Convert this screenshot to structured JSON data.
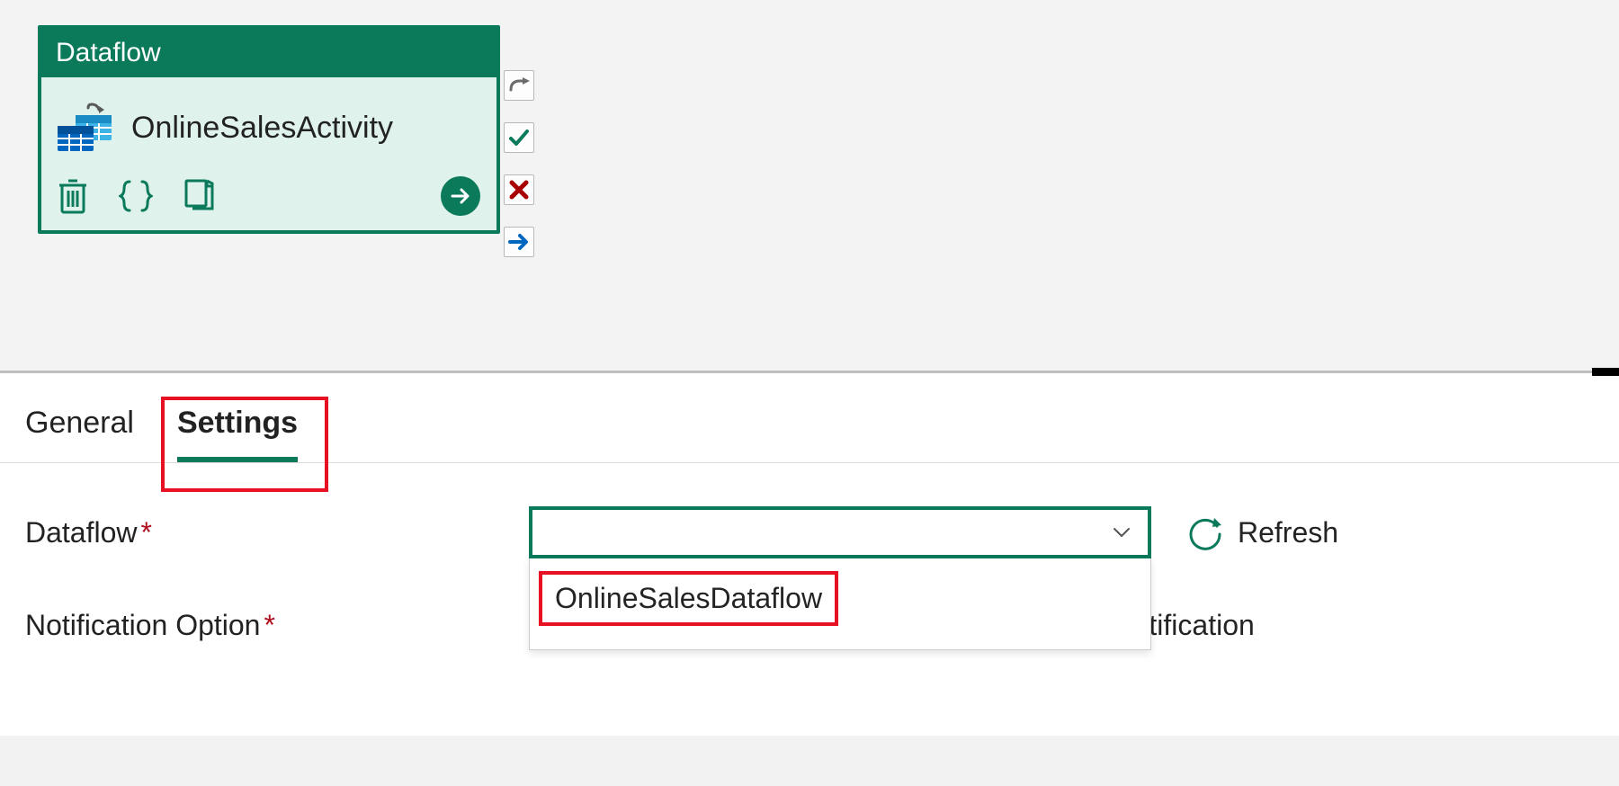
{
  "activity": {
    "type_label": "Dataflow",
    "name": "OnlineSalesActivity"
  },
  "tabs": {
    "general": "General",
    "settings": "Settings"
  },
  "form": {
    "dataflow_label": "Dataflow",
    "notification_label": "Notification Option",
    "refresh_label": "Refresh",
    "dropdown": {
      "value": "",
      "options": [
        "OnlineSalesDataflow"
      ]
    },
    "no_notification_label": "No notification"
  }
}
